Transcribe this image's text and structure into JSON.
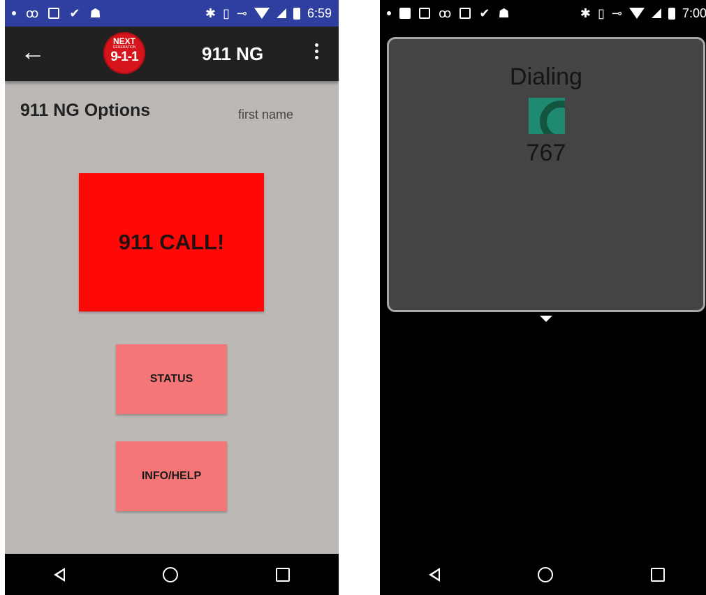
{
  "left_screen": {
    "status_bar": {
      "icons": [
        "notification-dot",
        "voicemail-icon",
        "download-icon",
        "clipboard-check-icon",
        "android-icon"
      ],
      "right_icons": [
        "bluetooth-icon",
        "vibrate-icon",
        "vpn-key-icon",
        "wifi-icon",
        "signal-icon",
        "battery-icon"
      ],
      "time": "6:59",
      "color": "#2f3f9f"
    },
    "app_bar": {
      "logo": {
        "top": "NEXT",
        "middle": "GENERATION",
        "bottom": "9-1-1"
      },
      "title": "911 NG"
    },
    "options_title": "911 NG Options",
    "first_name": "first name",
    "call_button": "911 CALL!",
    "status_button": "STATUS",
    "info_button": "INFO/HELP",
    "colors": {
      "background": "#bcb8b6",
      "call": "#ff0808",
      "secondary": "#f47676"
    }
  },
  "right_screen": {
    "status_bar": {
      "icons": [
        "notification-dot",
        "square-icon",
        "image-icon",
        "voicemail-icon",
        "download-icon",
        "clipboard-check-icon",
        "android-icon"
      ],
      "right_icons": [
        "bluetooth-icon",
        "vibrate-icon",
        "vpn-key-icon",
        "wifi-icon",
        "signal-icon",
        "battery-icon"
      ],
      "time": "7:00",
      "color": "#000000"
    },
    "dialog": {
      "title": "Dialing",
      "number": "767",
      "avatar_color": "#1f8a70"
    }
  }
}
